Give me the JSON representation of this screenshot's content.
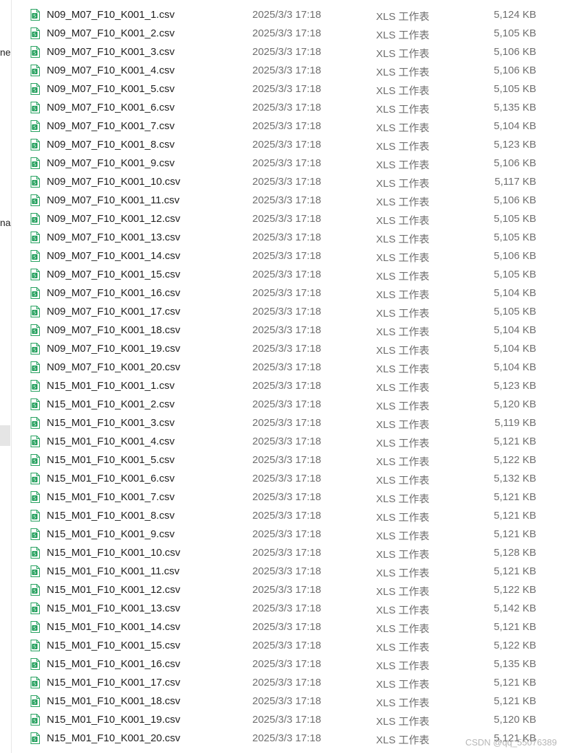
{
  "nav_pane": {
    "fragments": [
      "ne",
      "na"
    ]
  },
  "file_icon": {
    "name": "csv-spreadsheet-icon",
    "color": "#1f9e5a"
  },
  "files": [
    {
      "name": "N09_M07_F10_K001_1.csv",
      "date": "2025/3/3 17:18",
      "type": "XLS 工作表",
      "size": "5,124 KB"
    },
    {
      "name": "N09_M07_F10_K001_2.csv",
      "date": "2025/3/3 17:18",
      "type": "XLS 工作表",
      "size": "5,105 KB"
    },
    {
      "name": "N09_M07_F10_K001_3.csv",
      "date": "2025/3/3 17:18",
      "type": "XLS 工作表",
      "size": "5,106 KB"
    },
    {
      "name": "N09_M07_F10_K001_4.csv",
      "date": "2025/3/3 17:18",
      "type": "XLS 工作表",
      "size": "5,106 KB"
    },
    {
      "name": "N09_M07_F10_K001_5.csv",
      "date": "2025/3/3 17:18",
      "type": "XLS 工作表",
      "size": "5,105 KB"
    },
    {
      "name": "N09_M07_F10_K001_6.csv",
      "date": "2025/3/3 17:18",
      "type": "XLS 工作表",
      "size": "5,135 KB"
    },
    {
      "name": "N09_M07_F10_K001_7.csv",
      "date": "2025/3/3 17:18",
      "type": "XLS 工作表",
      "size": "5,104 KB"
    },
    {
      "name": "N09_M07_F10_K001_8.csv",
      "date": "2025/3/3 17:18",
      "type": "XLS 工作表",
      "size": "5,123 KB"
    },
    {
      "name": "N09_M07_F10_K001_9.csv",
      "date": "2025/3/3 17:18",
      "type": "XLS 工作表",
      "size": "5,106 KB"
    },
    {
      "name": "N09_M07_F10_K001_10.csv",
      "date": "2025/3/3 17:18",
      "type": "XLS 工作表",
      "size": "5,117 KB"
    },
    {
      "name": "N09_M07_F10_K001_11.csv",
      "date": "2025/3/3 17:18",
      "type": "XLS 工作表",
      "size": "5,106 KB"
    },
    {
      "name": "N09_M07_F10_K001_12.csv",
      "date": "2025/3/3 17:18",
      "type": "XLS 工作表",
      "size": "5,105 KB"
    },
    {
      "name": "N09_M07_F10_K001_13.csv",
      "date": "2025/3/3 17:18",
      "type": "XLS 工作表",
      "size": "5,105 KB"
    },
    {
      "name": "N09_M07_F10_K001_14.csv",
      "date": "2025/3/3 17:18",
      "type": "XLS 工作表",
      "size": "5,106 KB"
    },
    {
      "name": "N09_M07_F10_K001_15.csv",
      "date": "2025/3/3 17:18",
      "type": "XLS 工作表",
      "size": "5,105 KB"
    },
    {
      "name": "N09_M07_F10_K001_16.csv",
      "date": "2025/3/3 17:18",
      "type": "XLS 工作表",
      "size": "5,104 KB"
    },
    {
      "name": "N09_M07_F10_K001_17.csv",
      "date": "2025/3/3 17:18",
      "type": "XLS 工作表",
      "size": "5,105 KB"
    },
    {
      "name": "N09_M07_F10_K001_18.csv",
      "date": "2025/3/3 17:18",
      "type": "XLS 工作表",
      "size": "5,104 KB"
    },
    {
      "name": "N09_M07_F10_K001_19.csv",
      "date": "2025/3/3 17:18",
      "type": "XLS 工作表",
      "size": "5,104 KB"
    },
    {
      "name": "N09_M07_F10_K001_20.csv",
      "date": "2025/3/3 17:18",
      "type": "XLS 工作表",
      "size": "5,104 KB"
    },
    {
      "name": "N15_M01_F10_K001_1.csv",
      "date": "2025/3/3 17:18",
      "type": "XLS 工作表",
      "size": "5,123 KB"
    },
    {
      "name": "N15_M01_F10_K001_2.csv",
      "date": "2025/3/3 17:18",
      "type": "XLS 工作表",
      "size": "5,120 KB"
    },
    {
      "name": "N15_M01_F10_K001_3.csv",
      "date": "2025/3/3 17:18",
      "type": "XLS 工作表",
      "size": "5,119 KB"
    },
    {
      "name": "N15_M01_F10_K001_4.csv",
      "date": "2025/3/3 17:18",
      "type": "XLS 工作表",
      "size": "5,121 KB"
    },
    {
      "name": "N15_M01_F10_K001_5.csv",
      "date": "2025/3/3 17:18",
      "type": "XLS 工作表",
      "size": "5,122 KB"
    },
    {
      "name": "N15_M01_F10_K001_6.csv",
      "date": "2025/3/3 17:18",
      "type": "XLS 工作表",
      "size": "5,132 KB"
    },
    {
      "name": "N15_M01_F10_K001_7.csv",
      "date": "2025/3/3 17:18",
      "type": "XLS 工作表",
      "size": "5,121 KB"
    },
    {
      "name": "N15_M01_F10_K001_8.csv",
      "date": "2025/3/3 17:18",
      "type": "XLS 工作表",
      "size": "5,121 KB"
    },
    {
      "name": "N15_M01_F10_K001_9.csv",
      "date": "2025/3/3 17:18",
      "type": "XLS 工作表",
      "size": "5,121 KB"
    },
    {
      "name": "N15_M01_F10_K001_10.csv",
      "date": "2025/3/3 17:18",
      "type": "XLS 工作表",
      "size": "5,128 KB"
    },
    {
      "name": "N15_M01_F10_K001_11.csv",
      "date": "2025/3/3 17:18",
      "type": "XLS 工作表",
      "size": "5,121 KB"
    },
    {
      "name": "N15_M01_F10_K001_12.csv",
      "date": "2025/3/3 17:18",
      "type": "XLS 工作表",
      "size": "5,122 KB"
    },
    {
      "name": "N15_M01_F10_K001_13.csv",
      "date": "2025/3/3 17:18",
      "type": "XLS 工作表",
      "size": "5,142 KB"
    },
    {
      "name": "N15_M01_F10_K001_14.csv",
      "date": "2025/3/3 17:18",
      "type": "XLS 工作表",
      "size": "5,121 KB"
    },
    {
      "name": "N15_M01_F10_K001_15.csv",
      "date": "2025/3/3 17:18",
      "type": "XLS 工作表",
      "size": "5,122 KB"
    },
    {
      "name": "N15_M01_F10_K001_16.csv",
      "date": "2025/3/3 17:18",
      "type": "XLS 工作表",
      "size": "5,135 KB"
    },
    {
      "name": "N15_M01_F10_K001_17.csv",
      "date": "2025/3/3 17:18",
      "type": "XLS 工作表",
      "size": "5,121 KB"
    },
    {
      "name": "N15_M01_F10_K001_18.csv",
      "date": "2025/3/3 17:18",
      "type": "XLS 工作表",
      "size": "5,121 KB"
    },
    {
      "name": "N15_M01_F10_K001_19.csv",
      "date": "2025/3/3 17:18",
      "type": "XLS 工作表",
      "size": "5,120 KB"
    },
    {
      "name": "N15_M01_F10_K001_20.csv",
      "date": "2025/3/3 17:18",
      "type": "XLS 工作表",
      "size": "5,121 KB"
    }
  ],
  "watermark": "CSDN @qq_55076389"
}
